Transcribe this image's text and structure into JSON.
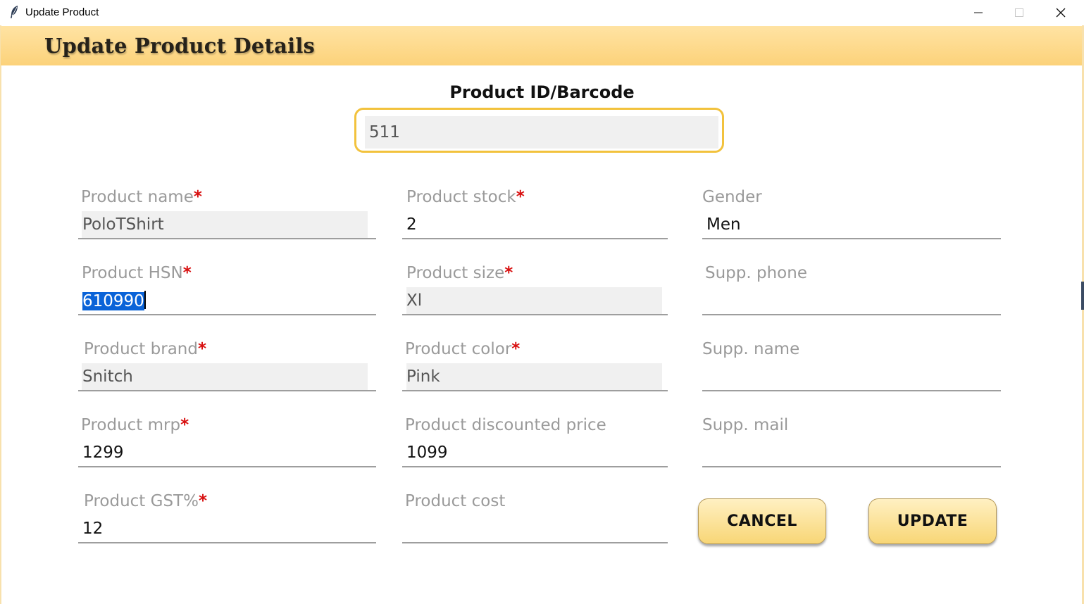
{
  "window": {
    "title": "Update Product"
  },
  "header": {
    "title": "Update Product Details"
  },
  "product_id": {
    "label": "Product ID/Barcode",
    "value": "511"
  },
  "fields": {
    "product_name": {
      "label": "Product name",
      "required": "*",
      "value": "PoloTShirt"
    },
    "product_stock": {
      "label": "Product stock",
      "required": "*",
      "value": "2"
    },
    "gender": {
      "label": "Gender",
      "value": "Men"
    },
    "product_hsn": {
      "label": "Product HSN",
      "required": "*",
      "value": "610990"
    },
    "product_size": {
      "label": "Product size",
      "required": "*",
      "value": "Xl"
    },
    "supp_phone": {
      "label": "Supp. phone",
      "value": ""
    },
    "product_brand": {
      "label": "Product brand",
      "required": "*",
      "value": "Snitch"
    },
    "product_color": {
      "label": "Product color",
      "required": "*",
      "value": "Pink"
    },
    "supp_name": {
      "label": "Supp. name",
      "value": ""
    },
    "product_mrp": {
      "label": "Product mrp",
      "required": "*",
      "value": "1299"
    },
    "product_discounted_price": {
      "label": "Product discounted price",
      "value": "1099"
    },
    "supp_mail": {
      "label": "Supp. mail",
      "value": ""
    },
    "product_gst": {
      "label": "Product GST%",
      "required": "*",
      "value": "12"
    },
    "product_cost": {
      "label": "Product cost",
      "value": ""
    }
  },
  "buttons": {
    "cancel": "CANCEL",
    "update": "UPDATE"
  },
  "colors": {
    "header_bg": "#fcd27a",
    "accent_border": "#f2c23d",
    "required": "#d80f0f",
    "button_bg": "#f8d676",
    "selection": "#0a63d8"
  },
  "icons": {
    "app": "feather-icon",
    "minimize": "minimize-icon",
    "maximize": "maximize-icon",
    "close": "close-icon"
  }
}
